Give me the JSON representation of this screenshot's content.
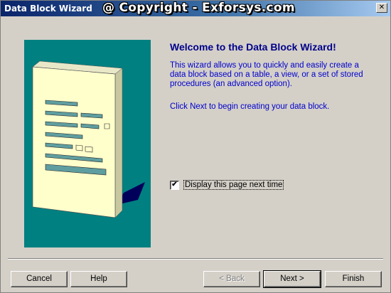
{
  "window": {
    "title": "Data Block Wizard",
    "watermark": "@ Copyright - Exforsys.com",
    "close_glyph": "✕"
  },
  "illustration": {
    "icon": "form-illustration-icon",
    "background_color": "#008080",
    "panel_color": "#ffffcc"
  },
  "content": {
    "heading": "Welcome to the Data Block Wizard!",
    "description": "This wizard allows you to quickly and easily create a data block based on a table, a view, or a set of stored procedures (an advanced option).",
    "instruction": "Click Next to begin creating your data block.",
    "checkbox_label": "Display this page next time",
    "checkbox_checked": true,
    "check_glyph": "✔"
  },
  "buttons": {
    "cancel": "Cancel",
    "help": "Help",
    "back": "< Back",
    "next": "Next >",
    "finish": "Finish"
  },
  "colors": {
    "heading": "#00008b",
    "body_text": "#0000cc",
    "title_bar": "#0a246a"
  }
}
